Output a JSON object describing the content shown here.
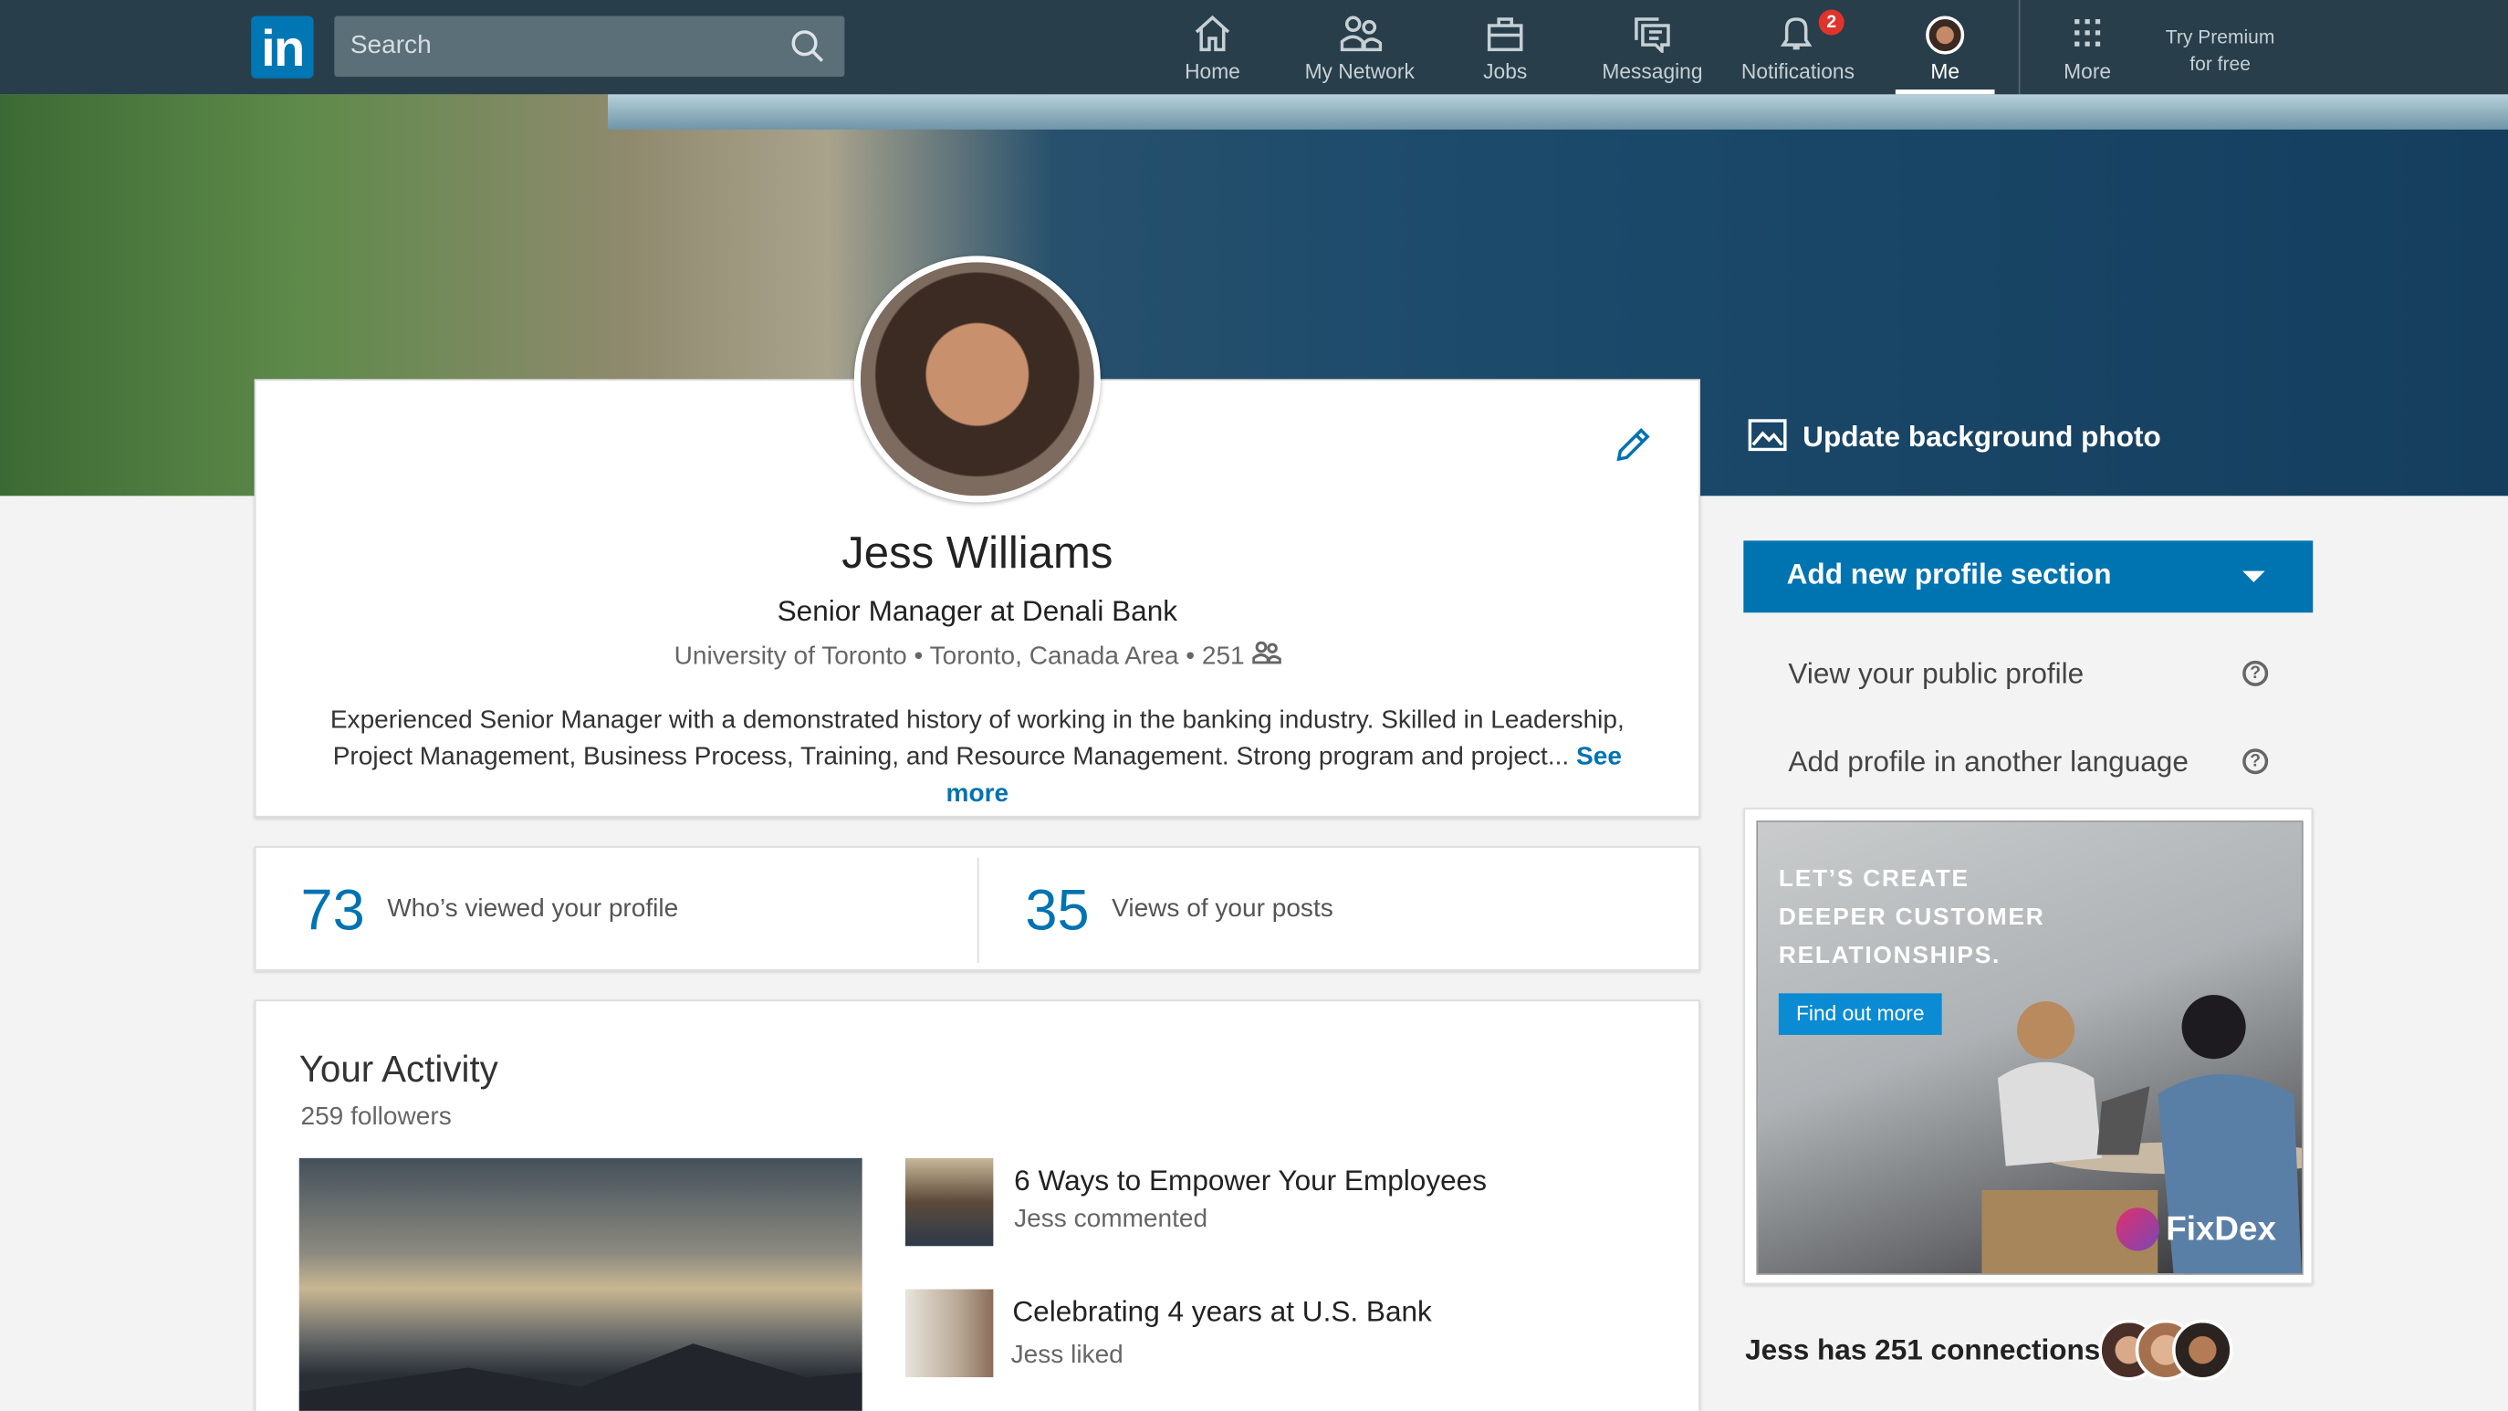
{
  "nav": {
    "logo": "in",
    "search_placeholder": "Search",
    "items": [
      {
        "label": "Home",
        "icon": "home-icon"
      },
      {
        "label": "My Network",
        "icon": "network-icon"
      },
      {
        "label": "Jobs",
        "icon": "briefcase-icon"
      },
      {
        "label": "Messaging",
        "icon": "messaging-icon"
      },
      {
        "label": "Notifications",
        "icon": "bell-icon",
        "badge": "2"
      },
      {
        "label": "Me",
        "icon": "avatar",
        "active": true
      },
      {
        "label": "More",
        "icon": "grid-icon"
      }
    ],
    "premium_line1": "Try Premium",
    "premium_line2": "for free"
  },
  "banner": {
    "update_label": "Update background photo"
  },
  "profile": {
    "name": "Jess Williams",
    "headline": "Senior Manager at Denali Bank",
    "school": "University of Toronto",
    "location": "Toronto, Canada Area",
    "connections": "251",
    "summary_line1": "Experienced Senior Manager with a demonstrated history of working in the banking industry. Skilled in Leadership,",
    "summary_line2": "Project Management, Business Process, Training, and Resource Management. Strong program and project...",
    "see_more": "See more"
  },
  "stats": [
    {
      "value": "73",
      "label": "Who’s viewed your profile"
    },
    {
      "value": "35",
      "label": "Views of your posts"
    }
  ],
  "activity": {
    "title": "Your Activity",
    "followers": "259 followers",
    "posts": [
      {
        "title": "6 Ways to Empower Your Employees",
        "sub": "Jess commented"
      },
      {
        "title": "Celebrating 4 years at U.S. Bank",
        "sub": "Jess liked"
      }
    ]
  },
  "sidebar": {
    "add_section": "Add new profile section",
    "links": [
      "View your public profile",
      "Add profile in another language"
    ],
    "ad": {
      "headline": [
        "LET’S CREATE",
        "DEEPER CUSTOMER",
        "RELATIONSHIPS."
      ],
      "cta": "Find out more",
      "brand": "FixDex"
    },
    "connections_text": "Jess has 251 connections"
  },
  "colors": {
    "nav_bg": "#283e4a",
    "accent": "#0073b1",
    "badge": "#e0332b"
  }
}
